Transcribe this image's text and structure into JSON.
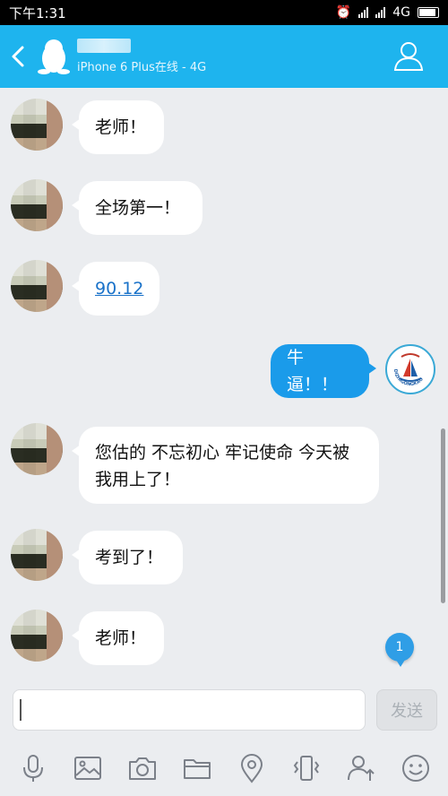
{
  "status_bar": {
    "time": "下午1:31",
    "network": "4G"
  },
  "header": {
    "device_status": "iPhone 6 Plus在线 - 4G"
  },
  "messages": [
    {
      "from": "other",
      "text": "老师！"
    },
    {
      "from": "other",
      "text": "全场第一！"
    },
    {
      "from": "other",
      "text": "90.12",
      "is_link": true
    },
    {
      "from": "me",
      "text": "牛逼！！",
      "avatar_text": "DIZHIGONGKAO"
    },
    {
      "from": "other",
      "text": "您估的 不忘初心 牢记使命 今天被我用上了！"
    },
    {
      "from": "other",
      "text": "考到了！"
    },
    {
      "from": "other",
      "text": "老师！"
    }
  ],
  "unread_count": "1",
  "input": {
    "value": "",
    "send_label": "发送"
  },
  "toolbar": {
    "icons": [
      "mic-icon",
      "image-icon",
      "camera-icon",
      "folder-icon",
      "location-icon",
      "shake-icon",
      "contact-share-icon",
      "emoji-icon"
    ]
  },
  "colors": {
    "header": "#1eb4ee",
    "my_bubble": "#1a9bea",
    "link": "#1a72c9",
    "background": "#ebedf0"
  }
}
